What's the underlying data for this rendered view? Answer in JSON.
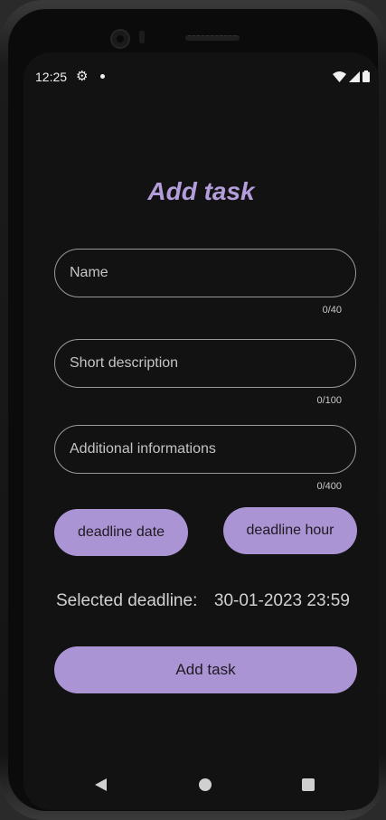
{
  "status_bar": {
    "time": "12:25",
    "settings_icon": "gear-icon",
    "notification_dot": "dot-icon",
    "wifi_icon": "wifi-icon",
    "signal_icon": "signal-icon",
    "battery_icon": "battery-icon"
  },
  "form": {
    "title": "Add task",
    "name": {
      "placeholder": "Name",
      "value": "",
      "counter": "0/40"
    },
    "short_description": {
      "placeholder": "Short description",
      "value": "",
      "counter": "0/100"
    },
    "additional_info": {
      "placeholder": "Additional informations",
      "value": "",
      "counter": "0/400"
    },
    "deadline_date_label": "deadline date",
    "deadline_hour_label": "deadline hour",
    "selected_deadline_label": "Selected deadline:",
    "selected_deadline_value": "30-01-2023 23:59",
    "submit_label": "Add task"
  },
  "nav_bar": {
    "back_icon": "back-triangle-icon",
    "home_icon": "home-circle-icon",
    "recents_icon": "recents-square-icon"
  },
  "colors": {
    "accent": "#ab94d3",
    "title": "#b39ddb",
    "background": "#121212"
  }
}
